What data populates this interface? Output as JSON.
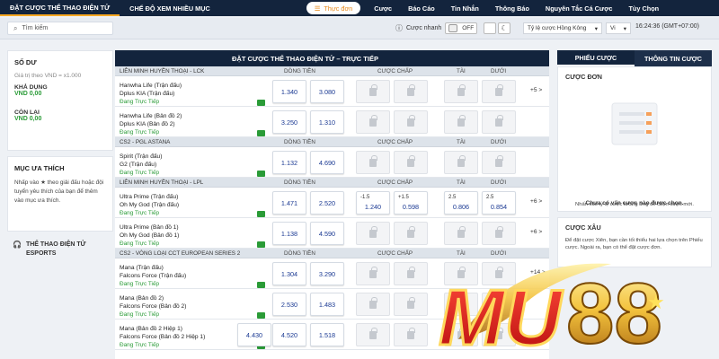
{
  "topnav": {
    "tabs": [
      "ĐẶT CƯỢC THỂ THAO ĐIỆN TỬ",
      "CHẾ ĐỘ XEM NHIỀU MỤC"
    ],
    "menu_button": "Thực đơn",
    "right_links": [
      "Cược",
      "Báo Cáo",
      "Tin Nhắn",
      "Thông Báo",
      "Nguyên Tắc Cá Cược",
      "Tùy Chọn"
    ]
  },
  "toolbar": {
    "search_placeholder": "Tìm kiếm",
    "quick_bet_label": "Cược nhanh",
    "quick_bet_state": "OFF",
    "odds_format": "Tỷ lệ cược Hồng Kông",
    "language": "Vi",
    "clock": "16:24:36 (GMT+07:00)"
  },
  "left": {
    "balance_title": "SỐ DƯ",
    "balance_note": "Giá trị theo VND = x1.000",
    "available_label": "KHẢ DỤNG",
    "available_value": "VND 0,00",
    "remaining_label": "CÒN LẠI",
    "remaining_value": "VND 0,00",
    "favorites_title": "MỤC ƯA THÍCH",
    "favorites_text": "Nhấp vào ★ theo giải đấu hoặc đội tuyển yêu thích của bạn để thêm vào mục ưa thích.",
    "esports_title": "THỂ THAO ĐIỆN TỬ ESPORTS"
  },
  "center": {
    "title": "ĐẶT CƯỢC THỂ THAO ĐIỆN TỬ – TRỰC TIẾP",
    "col_money": "DÒNG TIỀN",
    "col_handicap": "CƯỢC CHẤP",
    "col_over": "TÀI",
    "col_under": "DƯỚI",
    "live": "Đang Trực Tiếp",
    "groups": [
      {
        "name": "LIÊN MINH HUYỀN THOẠI - LCK",
        "matches": [
          {
            "t1": "Hanwha Life (Trận đấu)",
            "t2": "Dplus KIA (Trận đấu)",
            "o1": "1.340",
            "o2": "3.080",
            "more": "+5 >"
          },
          {
            "t1": "Hanwha Life (Bản đồ 2)",
            "t2": "Dplus KIA (Bản đồ 2)",
            "o1": "3.250",
            "o2": "1.310",
            "more": ""
          }
        ]
      },
      {
        "name": "CS2 - PGL ASTANA",
        "matches": [
          {
            "t1": "Spirit (Trận đấu)",
            "t2": "G2 (Trận đấu)",
            "o1": "1.132",
            "o2": "4.690",
            "more": ""
          }
        ]
      },
      {
        "name": "LIÊN MINH HUYỀN THOẠI - LPL",
        "matches": [
          {
            "t1": "Ultra Prime (Trận đấu)",
            "t2": "Oh My God (Trận đấu)",
            "o1": "1.471",
            "o2": "2.520",
            "h1": "-1.5",
            "h1v": "1.240",
            "h2": "+1.5",
            "h2v": "0.598",
            "ou": "2.5",
            "ov": "0.806",
            "uu": "2.5",
            "uv": "0.854",
            "more": "+6 >"
          },
          {
            "t1": "Ultra Prime (Bản đồ 1)",
            "t2": "Oh My God (Bản đồ 1)",
            "o1": "1.138",
            "o2": "4.590",
            "more": "+6 >"
          }
        ]
      },
      {
        "name": "CS2 - VÒNG LOẠI CCT EUROPEAN SERIES 2",
        "matches": [
          {
            "t1": "Mana (Trận đấu)",
            "t2": "Falcons Force (Trận đấu)",
            "o1": "1.304",
            "o2": "3.290",
            "more": "+14 >"
          },
          {
            "t1": "Mana (Bản đồ 2)",
            "t2": "Falcons Force (Bản đồ 2)",
            "o1": "2.530",
            "o2": "1.483",
            "more": ""
          },
          {
            "t1": "Mana (Bản đồ 2 Hiệp 1)",
            "t2": "Falcons Force (Bản đồ 2 Hiệp 1)",
            "o0": "4.430",
            "o1": "4.520",
            "o2": "1.518",
            "more": ""
          }
        ]
      }
    ]
  },
  "right": {
    "tab1": "PHIẾU CƯỢC",
    "tab2": "THÔNG TIN CƯỢC",
    "single_title": "CƯỢC ĐƠN",
    "single_empty": "Chưa có vấn cược nào được chọn.",
    "single_hint": "Nhấn vào tỷ lệ cược tương ứng để chọn cược mới.",
    "parlay_title": "CƯỢC XÂU",
    "parlay_text": "Để đặt cược Xiên, bạn cần tối thiểu hai lựa chọn trên Phiếu cược. Ngoài ra, bạn có thể đặt cược đơn."
  },
  "logo": {
    "text": "MU88"
  },
  "colors": {
    "navy": "#13243d",
    "accent": "#f7a823",
    "odds": "#1b3a93",
    "live": "#2a9b37"
  }
}
